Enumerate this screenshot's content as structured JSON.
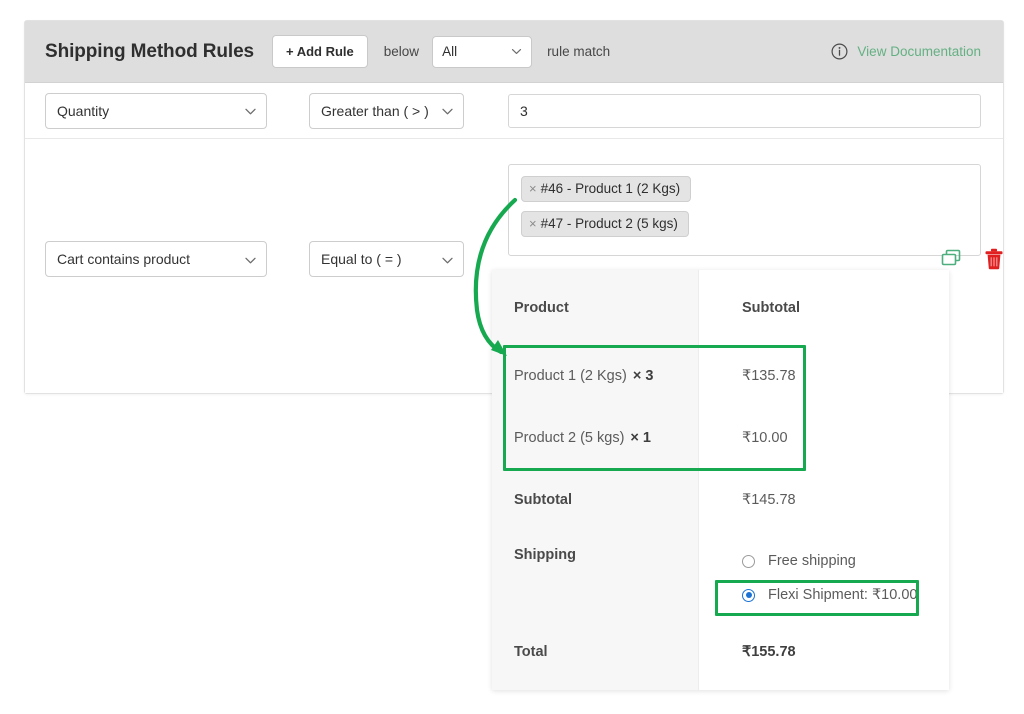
{
  "header": {
    "title": "Shipping Method Rules",
    "add_rule_label": "+ Add Rule",
    "below_label": "below",
    "match_value": "All",
    "rule_match_label": "rule match",
    "doc_link_label": "View Documentation",
    "doc_icon": "info-circle-icon",
    "link_color": "#64b083",
    "background": "#dedede"
  },
  "rules": [
    {
      "field": "Quantity",
      "operator": "Greater than ( > )",
      "value": "3",
      "value_placeholder": ""
    },
    {
      "field": "Cart contains product",
      "operator": "Equal to ( = )",
      "tags": [
        {
          "remove": "×",
          "label": "#46 - Product 1 (2 Kgs)"
        },
        {
          "remove": "×",
          "label": "#47 - Product 2 (5 kgs)"
        }
      ]
    }
  ],
  "row_actions": {
    "duplicate_icon": "duplicate-icon",
    "duplicate_color": "#4caf7d",
    "delete_icon": "trash-icon",
    "delete_color": "#e02020"
  },
  "cart": {
    "columns": {
      "product": "Product",
      "subtotal": "Subtotal"
    },
    "items": [
      {
        "name": "Product 1 (2 Kgs)",
        "qty": "× 3",
        "subtotal": "₹135.78"
      },
      {
        "name": "Product 2 (5 kgs)",
        "qty": "× 1",
        "subtotal": "₹10.00"
      }
    ],
    "subtotal_label": "Subtotal",
    "subtotal_value": "₹145.78",
    "shipping_label": "Shipping",
    "shipping_options": [
      {
        "label": "Free shipping",
        "selected": false
      },
      {
        "label": "Flexi Shipment: ₹10.00",
        "selected": true
      }
    ],
    "total_label": "Total",
    "total_value": "₹155.78"
  },
  "annotations": {
    "highlight_color": "#16a94f",
    "arrow": "curved-arrow-down",
    "boxes": [
      "cart-items-highlight",
      "flexi-shipment-highlight"
    ]
  }
}
